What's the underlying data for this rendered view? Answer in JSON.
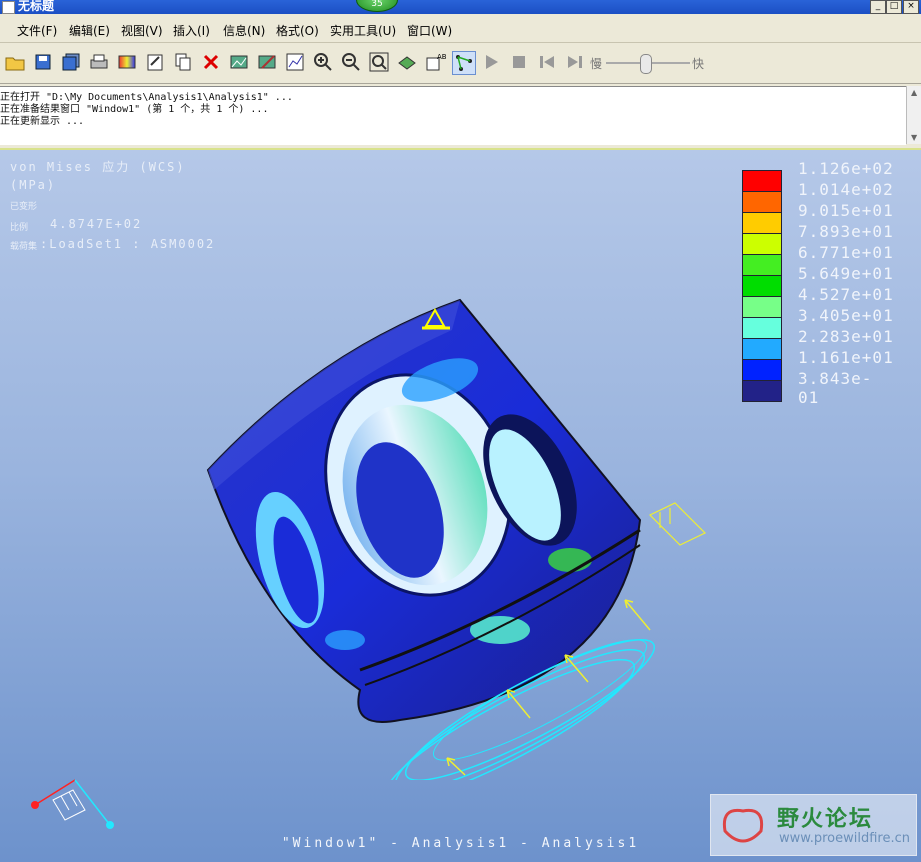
{
  "window": {
    "title": "无标题",
    "badge": "35",
    "controls": [
      "_",
      "□",
      "×"
    ]
  },
  "menu": [
    "文件(F)",
    "编辑(E)",
    "视图(V)",
    "插入(I)",
    "信息(N)",
    "格式(O)",
    "实用工具(U)",
    "窗口(W)"
  ],
  "toolbar": {
    "icons": [
      "open-folder-icon",
      "save-icon",
      "save-all-icon",
      "print-icon",
      "image-icon",
      "edit-doc-icon",
      "copy-icon",
      "delete-icon",
      "results-icon",
      "results-edit-icon",
      "chart-icon",
      "zoom-in-icon",
      "zoom-out-icon",
      "zoom-fit-icon",
      "orient-icon",
      "annotate-icon",
      "node-select-icon",
      "play-icon",
      "stop-icon",
      "skip-back-icon",
      "skip-forward-icon"
    ],
    "slider_slow": "慢",
    "slider_fast": "快"
  },
  "messages": [
    "正在打开 \"D:\\My Documents\\Analysis1\\Analysis1\" ...",
    "正在准备结果窗口 \"Window1\" (第 1 个，共 1 个) ...",
    "正在更新显示 ..."
  ],
  "overlay": {
    "line1": "von Mises 应力 (WCS)",
    "line2": "(MPa)",
    "line3": "已变形",
    "line4_label": "比例",
    "line4_value": "4.8747E+02",
    "line5_label": "载荷集",
    "line5_value": ":LoadSet1 :  ASM0002",
    "footer": "\"Window1\" - Analysis1 - Analysis1"
  },
  "legend": [
    {
      "value": "1.126e+02",
      "color": "#ff0000"
    },
    {
      "value": "1.014e+02",
      "color": "#ff6600"
    },
    {
      "value": "9.015e+01",
      "color": "#ffcc00"
    },
    {
      "value": "7.893e+01",
      "color": "#ccff00"
    },
    {
      "value": "6.771e+01",
      "color": "#44ee22"
    },
    {
      "value": "5.649e+01",
      "color": "#00dd00"
    },
    {
      "value": "4.527e+01",
      "color": "#77ff88"
    },
    {
      "value": "3.405e+01",
      "color": "#66ffdd"
    },
    {
      "value": "2.283e+01",
      "color": "#22aaff"
    },
    {
      "value": "1.161e+01",
      "color": "#0022ff"
    },
    {
      "value": "3.843e-01",
      "color": "#222288"
    }
  ],
  "logo": {
    "name": "野火论坛",
    "url": "www.proewildfire.cn"
  }
}
